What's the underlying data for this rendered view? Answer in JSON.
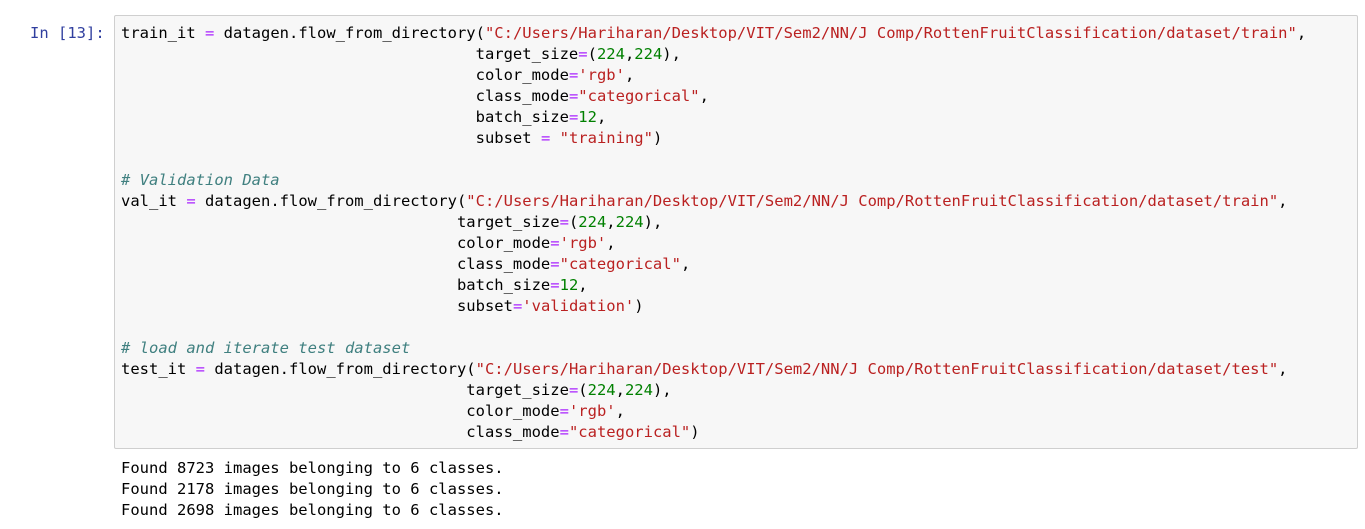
{
  "cell": {
    "prompt": "In [13]:",
    "code_lines": [
      [
        [
          "plain",
          "train_it "
        ],
        [
          "op",
          "="
        ],
        [
          "plain",
          " datagen.flow_from_directory("
        ],
        [
          "str",
          "\"C:/Users/Hariharan/Desktop/VIT/Sem2/NN/J Comp/RottenFruitClassification/dataset/train\""
        ],
        [
          "plain",
          ","
        ]
      ],
      [
        [
          "plain",
          "                                      target_size"
        ],
        [
          "op",
          "="
        ],
        [
          "plain",
          "("
        ],
        [
          "num",
          "224"
        ],
        [
          "plain",
          ","
        ],
        [
          "num",
          "224"
        ],
        [
          "plain",
          "),"
        ]
      ],
      [
        [
          "plain",
          "                                      color_mode"
        ],
        [
          "op",
          "="
        ],
        [
          "str",
          "'rgb'"
        ],
        [
          "plain",
          ","
        ]
      ],
      [
        [
          "plain",
          "                                      class_mode"
        ],
        [
          "op",
          "="
        ],
        [
          "str",
          "\"categorical\""
        ],
        [
          "plain",
          ","
        ]
      ],
      [
        [
          "plain",
          "                                      batch_size"
        ],
        [
          "op",
          "="
        ],
        [
          "num",
          "12"
        ],
        [
          "plain",
          ","
        ]
      ],
      [
        [
          "plain",
          "                                      subset "
        ],
        [
          "op",
          "="
        ],
        [
          "plain",
          " "
        ],
        [
          "str",
          "\"training\""
        ],
        [
          "plain",
          ")"
        ]
      ],
      [
        [
          "plain",
          ""
        ]
      ],
      [
        [
          "com",
          "# Validation Data"
        ]
      ],
      [
        [
          "plain",
          "val_it "
        ],
        [
          "op",
          "="
        ],
        [
          "plain",
          " datagen.flow_from_directory("
        ],
        [
          "str",
          "\"C:/Users/Hariharan/Desktop/VIT/Sem2/NN/J Comp/RottenFruitClassification/dataset/train\""
        ],
        [
          "plain",
          ","
        ]
      ],
      [
        [
          "plain",
          "                                    target_size"
        ],
        [
          "op",
          "="
        ],
        [
          "plain",
          "("
        ],
        [
          "num",
          "224"
        ],
        [
          "plain",
          ","
        ],
        [
          "num",
          "224"
        ],
        [
          "plain",
          "),"
        ]
      ],
      [
        [
          "plain",
          "                                    color_mode"
        ],
        [
          "op",
          "="
        ],
        [
          "str",
          "'rgb'"
        ],
        [
          "plain",
          ","
        ]
      ],
      [
        [
          "plain",
          "                                    class_mode"
        ],
        [
          "op",
          "="
        ],
        [
          "str",
          "\"categorical\""
        ],
        [
          "plain",
          ","
        ]
      ],
      [
        [
          "plain",
          "                                    batch_size"
        ],
        [
          "op",
          "="
        ],
        [
          "num",
          "12"
        ],
        [
          "plain",
          ","
        ]
      ],
      [
        [
          "plain",
          "                                    subset"
        ],
        [
          "op",
          "="
        ],
        [
          "str",
          "'validation'"
        ],
        [
          "plain",
          ")"
        ]
      ],
      [
        [
          "plain",
          ""
        ]
      ],
      [
        [
          "com",
          "# load and iterate test dataset"
        ]
      ],
      [
        [
          "plain",
          "test_it "
        ],
        [
          "op",
          "="
        ],
        [
          "plain",
          " datagen.flow_from_directory("
        ],
        [
          "str",
          "\"C:/Users/Hariharan/Desktop/VIT/Sem2/NN/J Comp/RottenFruitClassification/dataset/test\""
        ],
        [
          "plain",
          ","
        ]
      ],
      [
        [
          "plain",
          "                                     target_size"
        ],
        [
          "op",
          "="
        ],
        [
          "plain",
          "("
        ],
        [
          "num",
          "224"
        ],
        [
          "plain",
          ","
        ],
        [
          "num",
          "224"
        ],
        [
          "plain",
          "),"
        ]
      ],
      [
        [
          "plain",
          "                                     color_mode"
        ],
        [
          "op",
          "="
        ],
        [
          "str",
          "'rgb'"
        ],
        [
          "plain",
          ","
        ]
      ],
      [
        [
          "plain",
          "                                     class_mode"
        ],
        [
          "op",
          "="
        ],
        [
          "str",
          "\"categorical\""
        ],
        [
          "plain",
          ")"
        ]
      ]
    ]
  },
  "output": {
    "lines": [
      "Found 8723 images belonging to 6 classes.",
      "Found 2178 images belonging to 6 classes.",
      "Found 2698 images belonging to 6 classes."
    ]
  },
  "colors": {
    "prompt": "#303f9f",
    "operator": "#aa22ff",
    "string": "#ba2121",
    "number": "#008000",
    "comment": "#408080",
    "cell_background": "#f7f7f7",
    "cell_border": "#cfcfcf"
  }
}
